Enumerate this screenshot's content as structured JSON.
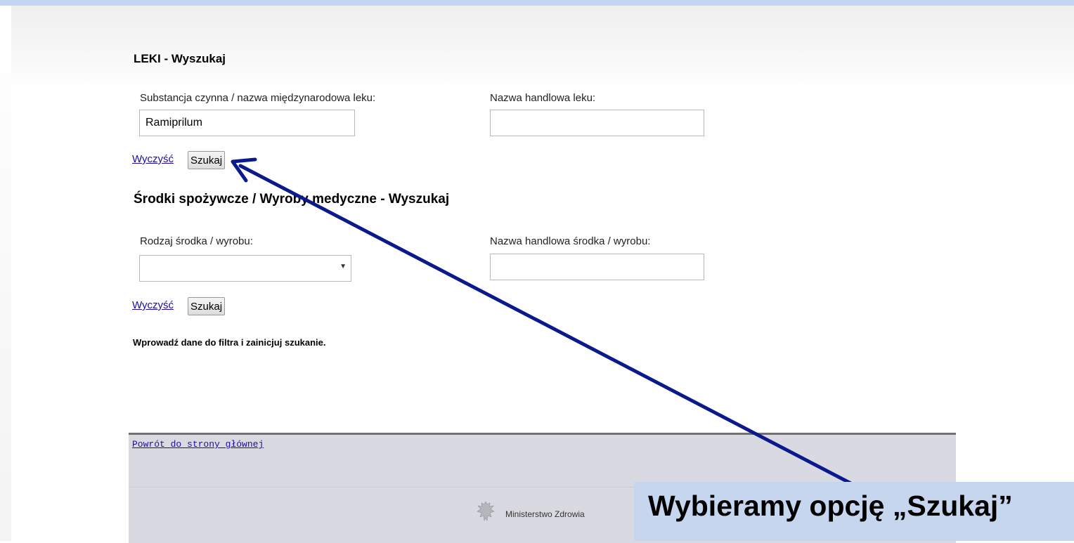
{
  "leki": {
    "title": "LEKI - Wyszukaj",
    "substance_label": "Substancja czynna / nazwa międzynarodowa leku:",
    "substance_value": "Ramiprilum",
    "trade_name_label": "Nazwa handlowa leku:",
    "trade_name_value": "",
    "clear_link": "Wyczyść",
    "search_button": "Szukaj"
  },
  "srodki": {
    "title": "Środki spożywcze / Wyroby medyczne - Wyszukaj",
    "type_label": "Rodzaj środka / wyrobu:",
    "type_selected": "",
    "trade_name_label": "Nazwa handlowa środka / wyrobu:",
    "trade_name_value": "",
    "clear_link": "Wyczyść",
    "search_button": "Szukaj"
  },
  "info_text": "Wprowadź dane do filtra i zainicjuj szukanie.",
  "footer": {
    "back_link": "Powrót do strony głównej",
    "ministry_name": "Ministerstwo Zdrowia"
  },
  "callout": {
    "text": "Wybieramy opcję „Szukaj”"
  },
  "colors": {
    "arrow": "#0a1a8c",
    "callout_bg": "#c7d6ef",
    "link": "#1a0dab"
  }
}
